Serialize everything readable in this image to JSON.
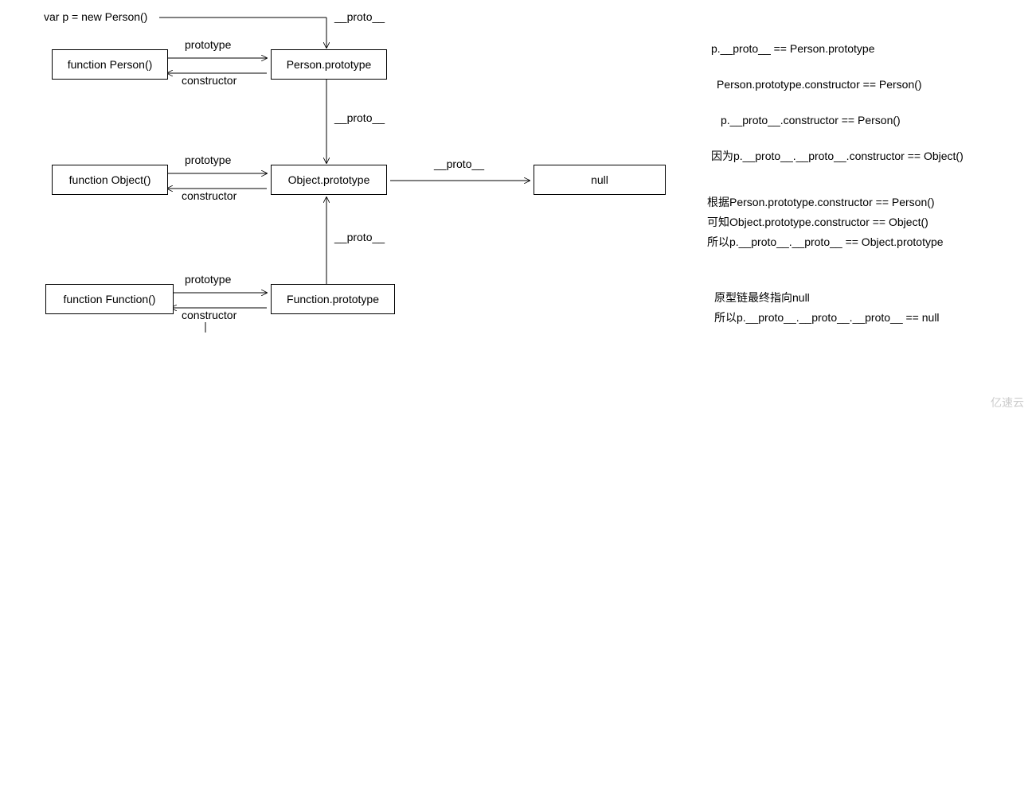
{
  "top": {
    "var_line": "var p = new Person()",
    "proto_label": "__proto__"
  },
  "boxes": {
    "person_fn": "function Person()",
    "person_proto": "Person.prototype",
    "object_fn": "function Object()",
    "object_proto": "Object.prototype",
    "function_fn": "function Function()",
    "function_proto": "Function.prototype",
    "null_box": "null"
  },
  "edge_labels": {
    "prototype": "prototype",
    "constructor": "constructor",
    "proto": "__proto__"
  },
  "notes": {
    "n1": "p.__proto__ == Person.prototype",
    "n2": "Person.prototype.constructor ==  Person()",
    "n3": "p.__proto__.constructor ==  Person()",
    "n4": "因为p.__proto__.__proto__.constructor == Object()",
    "n5": "根据Person.prototype.constructor == Person()",
    "n6": "可知Object.prototype.constructor == Object()",
    "n7": "所以p.__proto__.__proto__ == Object.prototype",
    "n8": "原型链最终指向null",
    "n9": "所以p.__proto__.__proto__.__proto__ == null"
  },
  "watermark": "亿速云"
}
